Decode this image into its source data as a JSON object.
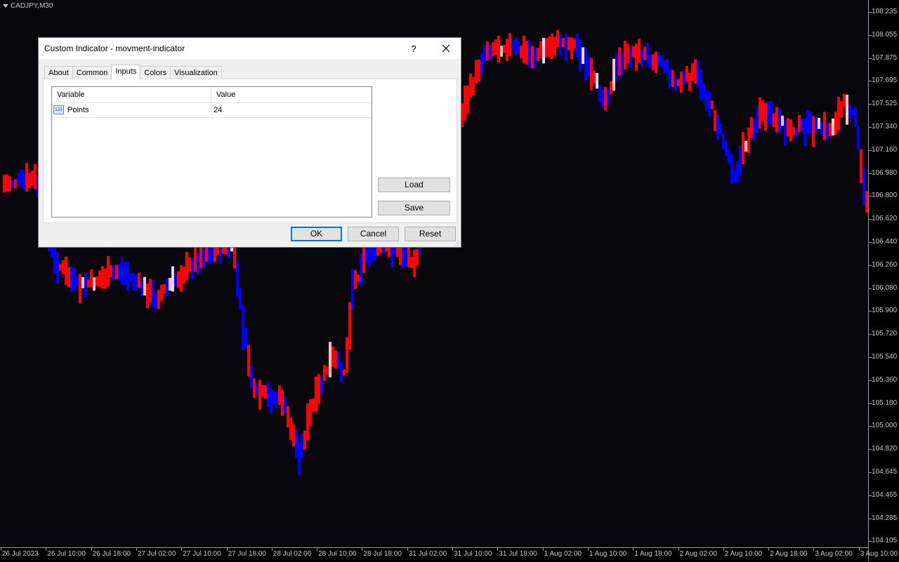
{
  "chart": {
    "symbol": "CADJPY,M30",
    "background": "#07070c",
    "bull_color": "#ff0000",
    "bear_color": "#0000ff",
    "price_labels": [
      "108.235",
      "108.055",
      "107.875",
      "107.695",
      "107.525",
      "107.340",
      "107.160",
      "106.980",
      "106.800",
      "106.620",
      "106.440",
      "106.260",
      "106.080",
      "105.900",
      "105.720",
      "105.540",
      "105.360",
      "105.180",
      "105.000",
      "104.820",
      "104.645",
      "104.465",
      "104.285",
      "104.105"
    ],
    "time_labels": [
      "26 Jul 2023",
      "26 Jul 10:00",
      "26 Jul 18:00",
      "27 Jul 02:00",
      "27 Jul 10:00",
      "27 Jul 18:00",
      "28 Jul 02:00",
      "28 Jul 10:00",
      "28 Jul 18:00",
      "31 Jul 02:00",
      "31 Jul 10:00",
      "31 Jul 18:00",
      "1 Aug 02:00",
      "1 Aug 10:00",
      "1 Aug 18:00",
      "2 Aug 02:00",
      "2 Aug 10:00",
      "2 Aug 18:00",
      "3 Aug 02:00",
      "3 Aug 10:00"
    ]
  },
  "dialog": {
    "title": "Custom Indicator - movment-indicator",
    "help_label": "?",
    "tabs": [
      {
        "label": "About",
        "active": false
      },
      {
        "label": "Common",
        "active": false
      },
      {
        "label": "Inputs",
        "active": true
      },
      {
        "label": "Colors",
        "active": false
      },
      {
        "label": "Visualization",
        "active": false
      }
    ],
    "table": {
      "headers": [
        "Variable",
        "Value"
      ],
      "rows": [
        {
          "icon": "numeric-input-icon",
          "icon_text": "123",
          "variable": "Points",
          "value": "24"
        }
      ]
    },
    "load_label": "Load",
    "save_label": "Save",
    "ok_label": "OK",
    "cancel_label": "Cancel",
    "reset_label": "Reset"
  }
}
